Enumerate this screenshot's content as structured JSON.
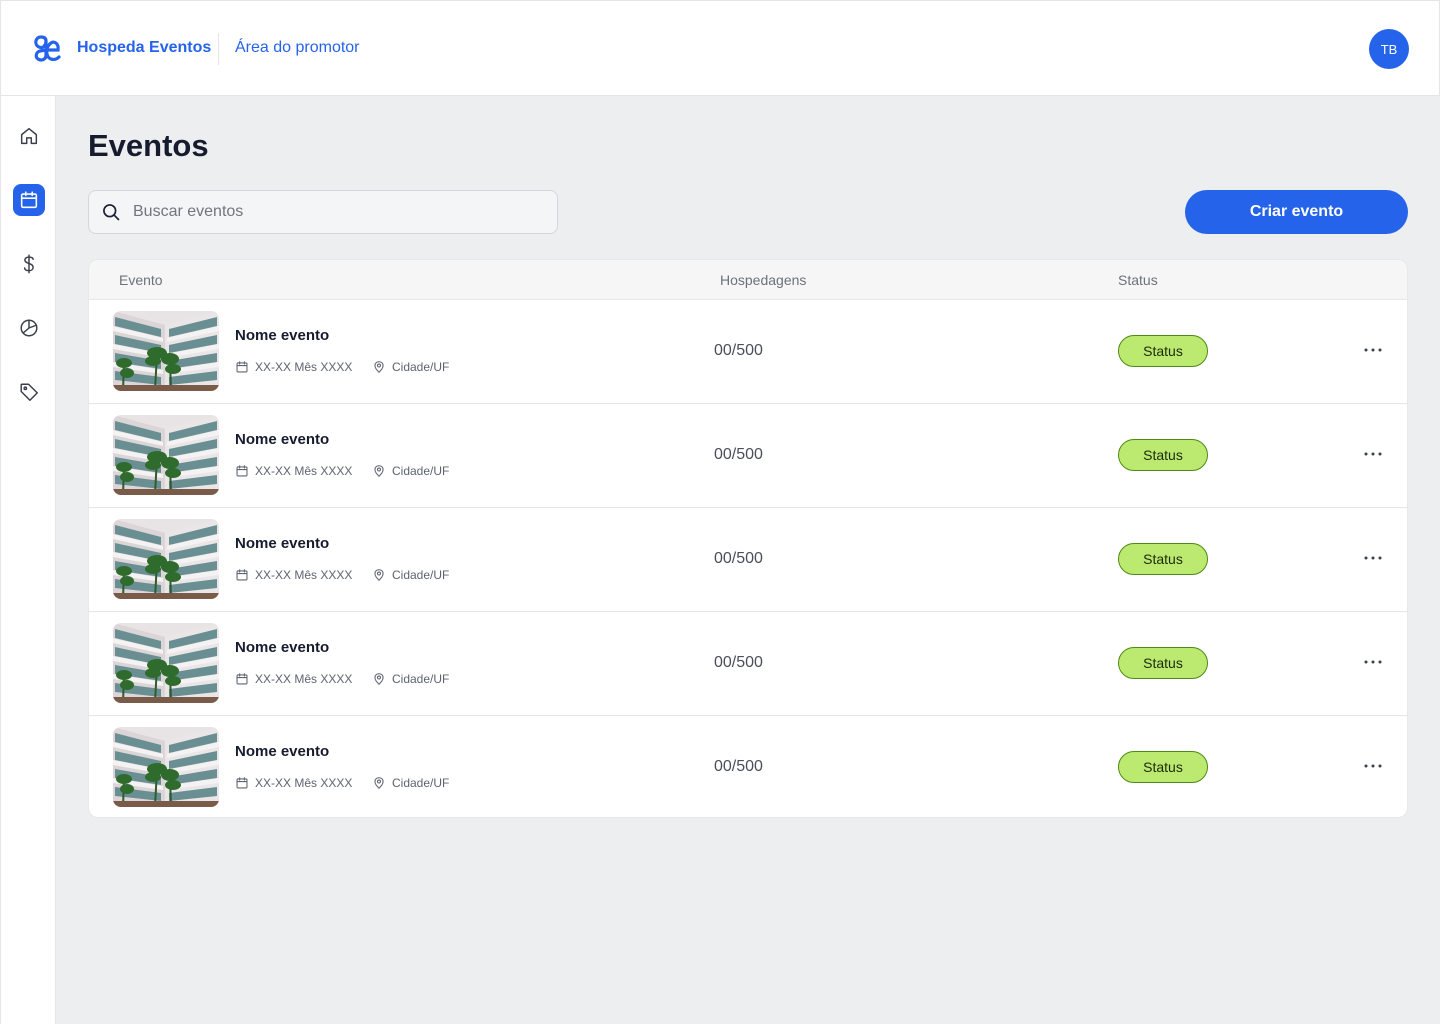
{
  "header": {
    "brand": "Hospeda Eventos",
    "area": "Área do promotor",
    "avatar_initials": "TB",
    "logo_icon": "ae-ligature-logo"
  },
  "sidebar": {
    "items": [
      {
        "icon": "home-icon",
        "active": false
      },
      {
        "icon": "calendar-icon",
        "active": true
      },
      {
        "icon": "dollar-icon",
        "active": false
      },
      {
        "icon": "pie-chart-icon",
        "active": false
      },
      {
        "icon": "tag-icon",
        "active": false
      }
    ]
  },
  "page": {
    "title": "Eventos",
    "search_placeholder": "Buscar eventos",
    "create_label": "Criar evento"
  },
  "table": {
    "columns": [
      "Evento",
      "Hospedagens",
      "Status"
    ],
    "rows": [
      {
        "name": "Nome evento",
        "date": "XX-XX Mês XXXX",
        "location": "Cidade/UF",
        "lodging": "00/500",
        "status": "Status"
      },
      {
        "name": "Nome evento",
        "date": "XX-XX Mês XXXX",
        "location": "Cidade/UF",
        "lodging": "00/500",
        "status": "Status"
      },
      {
        "name": "Nome evento",
        "date": "XX-XX Mês XXXX",
        "location": "Cidade/UF",
        "lodging": "00/500",
        "status": "Status"
      },
      {
        "name": "Nome evento",
        "date": "XX-XX Mês XXXX",
        "location": "Cidade/UF",
        "lodging": "00/500",
        "status": "Status"
      },
      {
        "name": "Nome evento",
        "date": "XX-XX Mês XXXX",
        "location": "Cidade/UF",
        "lodging": "00/500",
        "status": "Status"
      }
    ]
  },
  "colors": {
    "primary": "#2563eb",
    "status_bg": "#bce96f",
    "status_border": "#4e8a14",
    "page_bg": "#edeef0"
  }
}
